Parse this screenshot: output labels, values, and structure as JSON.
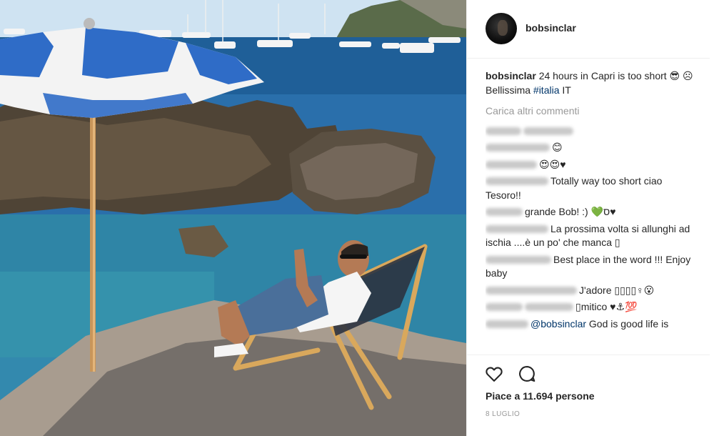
{
  "photo": {
    "alt_icon": "beach-photo",
    "colors": {
      "sea": "#2a6fab",
      "umbrella_blue": "#2f6cc7",
      "umbrella_white": "#f3f3f3",
      "rock": "#4f4436",
      "sand": "#a89c8f"
    }
  },
  "header": {
    "username": "bobsinclar",
    "avatar_icon": "profile-avatar"
  },
  "caption": {
    "username": "bobsinclar",
    "text": "24 hours in Capri is too short 😎 ☹ Bellissima",
    "hashtag": "#italia",
    "suffix": " IT"
  },
  "load_more": "Carica altri commenti",
  "comments": [
    {
      "user_blur": true,
      "text": "@"
    },
    {
      "user_blur": true,
      "text": "😊"
    },
    {
      "user_blur": true,
      "text": "😍😍♥"
    },
    {
      "user_visible_tail": "_",
      "text": "Totally way too short ciao Tesoro!!"
    },
    {
      "user_blur": true,
      "text": "grande Bob! :) 💚ס♥"
    },
    {
      "user_blur": true,
      "text": "La prossima volta si allunghi ad ischia ....è un po' che manca ▯"
    },
    {
      "user_blur": true,
      "text": "Best place in the word !!! Enjoy baby"
    },
    {
      "user_blur": true,
      "text": "J'adore ▯▯▯▯♀😮"
    },
    {
      "user_blur": true,
      "text": "▯mitico ♥⚓💯"
    },
    {
      "user_blur": true,
      "mention": "@bobsinclar",
      "text": "God is good life is"
    }
  ],
  "actions": {
    "like_icon": "heart-outline-icon",
    "comment_icon": "speech-bubble-icon",
    "likes_label": "Piace a 11.694 persone",
    "date": "8 LUGLIO"
  }
}
